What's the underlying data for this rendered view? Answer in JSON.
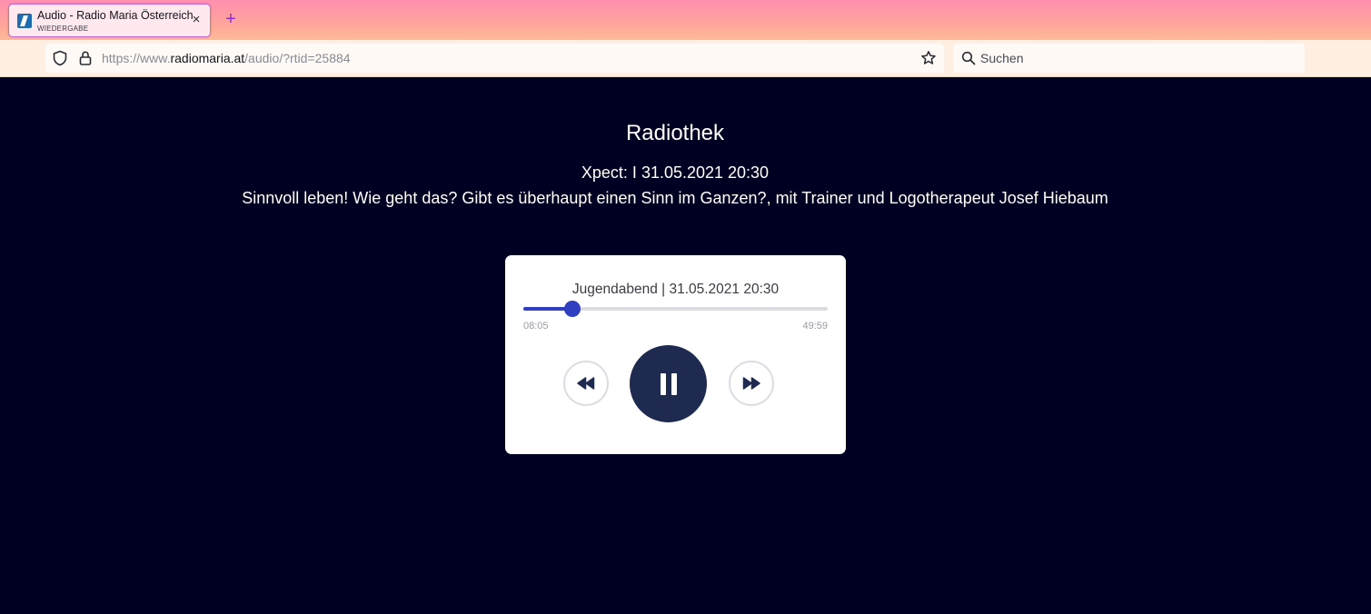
{
  "browser": {
    "tab": {
      "title": "Audio - Radio Maria Österreich",
      "subtitle": "WIEDERGABE"
    },
    "new_tab_symbol": "+",
    "close_symbol": "×",
    "url": {
      "prefix": "https://www.",
      "host": "radiomaria.at",
      "path": "/audio/?rtid=25884"
    },
    "search": {
      "placeholder": "Suchen"
    },
    "icons": [
      "favicon-radio-maria",
      "shield-icon",
      "lock-icon",
      "star-icon",
      "search-icon"
    ]
  },
  "page": {
    "title": "Radiothek",
    "show_line": "Xpect: I 31.05.2021 20:30",
    "description": "Sinnvoll leben! Wie geht das? Gibt es überhaupt einen Sinn im Ganzen?, mit Trainer und Logotherapeut Josef Hiebaum"
  },
  "player": {
    "track_title": "Jugendabend | 31.05.2021 20:30",
    "elapsed": "08:05",
    "total": "49:59",
    "progress_fraction": 0.1617,
    "state": "playing",
    "colors": {
      "accent": "#2f3fbf",
      "play_button": "#1e2a50",
      "background": "#000022"
    },
    "controls": [
      "rewind-icon",
      "pause-icon",
      "fast-forward-icon"
    ]
  }
}
